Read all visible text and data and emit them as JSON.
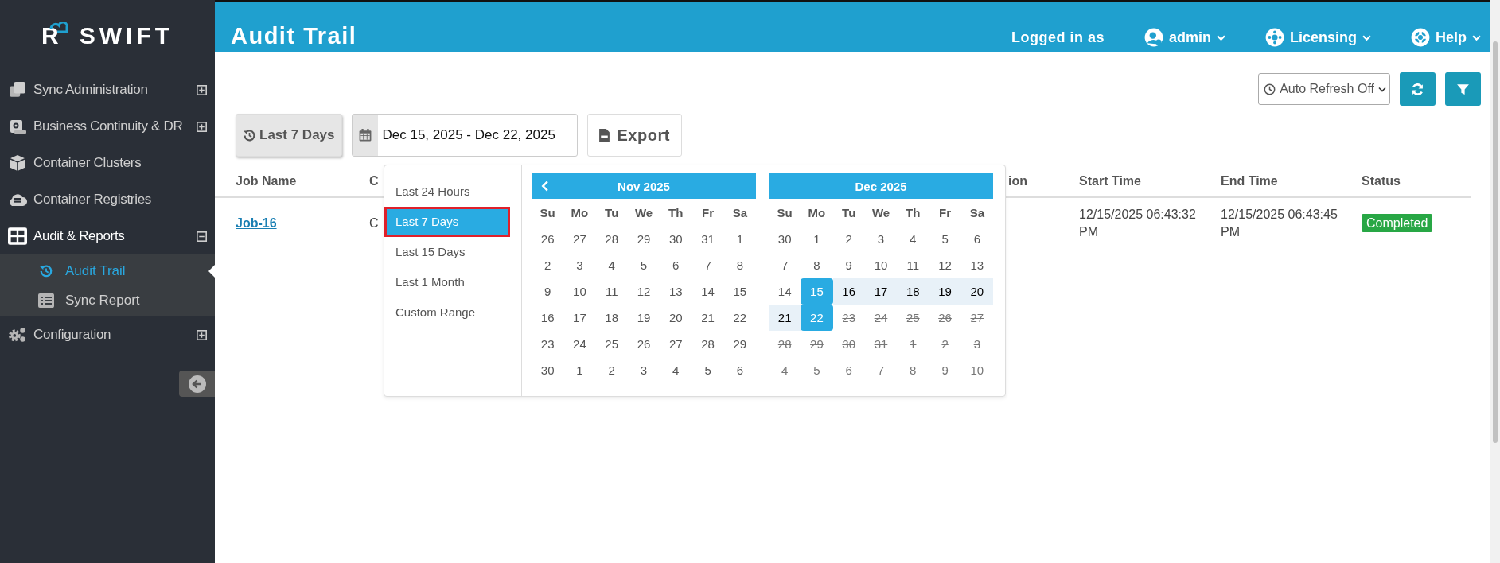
{
  "brand": {
    "mark": "R",
    "name": "SWIFT"
  },
  "sidebar": {
    "items": [
      {
        "label": "Sync Administration",
        "expanded": false
      },
      {
        "label": "Business Continuity & DR",
        "expanded": false
      },
      {
        "label": "Container Clusters"
      },
      {
        "label": "Container Registries"
      },
      {
        "label": "Audit & Reports",
        "expanded": true,
        "children": [
          {
            "label": "Audit Trail",
            "selected": true
          },
          {
            "label": "Sync Report",
            "selected": false
          }
        ]
      },
      {
        "label": "Configuration",
        "expanded": false
      }
    ]
  },
  "header": {
    "title": "Audit Trail",
    "logged_in_label": "Logged in as",
    "menus": [
      {
        "label": "admin"
      },
      {
        "label": "Licensing"
      },
      {
        "label": "Help"
      }
    ]
  },
  "toolbar": {
    "auto_refresh": "Auto Refresh Off",
    "preset_button": "Last 7 Days",
    "date_range": "Dec 15, 2025 - Dec 22, 2025",
    "export_button": "Export"
  },
  "table": {
    "columns": [
      "Job Name",
      "C",
      "ion",
      "Start Time",
      "End Time",
      "Status"
    ],
    "rows": [
      {
        "job": "Job-16",
        "column_2": "C",
        "start": "12/15/2025 06:43:32 PM",
        "end": "12/15/2025 06:43:45 PM",
        "status": "Completed"
      }
    ]
  },
  "date_picker": {
    "ranges": [
      {
        "label": "Last 24 Hours",
        "selected": false,
        "outlined": false
      },
      {
        "label": "Last 7 Days",
        "selected": true,
        "outlined": true
      },
      {
        "label": "Last 15 Days",
        "selected": false,
        "outlined": false
      },
      {
        "label": "Last 1 Month",
        "selected": false,
        "outlined": false
      },
      {
        "label": "Custom Range",
        "selected": false,
        "outlined": false
      }
    ],
    "months": [
      {
        "title": "Nov 2025",
        "weekdays": [
          "Su",
          "Mo",
          "Tu",
          "We",
          "Th",
          "Fr",
          "Sa"
        ],
        "weeks": [
          [
            {
              "d": "26",
              "kind": "normal"
            },
            {
              "d": "27",
              "kind": "normal"
            },
            {
              "d": "28",
              "kind": "normal"
            },
            {
              "d": "29",
              "kind": "normal"
            },
            {
              "d": "30",
              "kind": "normal"
            },
            {
              "d": "31",
              "kind": "normal"
            },
            {
              "d": "1",
              "kind": "normal"
            }
          ],
          [
            {
              "d": "2",
              "kind": "normal"
            },
            {
              "d": "3",
              "kind": "normal"
            },
            {
              "d": "4",
              "kind": "normal"
            },
            {
              "d": "5",
              "kind": "normal"
            },
            {
              "d": "6",
              "kind": "normal"
            },
            {
              "d": "7",
              "kind": "normal"
            },
            {
              "d": "8",
              "kind": "normal"
            }
          ],
          [
            {
              "d": "9",
              "kind": "normal"
            },
            {
              "d": "10",
              "kind": "normal"
            },
            {
              "d": "11",
              "kind": "normal"
            },
            {
              "d": "12",
              "kind": "normal"
            },
            {
              "d": "13",
              "kind": "normal"
            },
            {
              "d": "14",
              "kind": "normal"
            },
            {
              "d": "15",
              "kind": "normal"
            }
          ],
          [
            {
              "d": "16",
              "kind": "normal"
            },
            {
              "d": "17",
              "kind": "normal"
            },
            {
              "d": "18",
              "kind": "normal"
            },
            {
              "d": "19",
              "kind": "normal"
            },
            {
              "d": "20",
              "kind": "normal"
            },
            {
              "d": "21",
              "kind": "normal"
            },
            {
              "d": "22",
              "kind": "normal"
            }
          ],
          [
            {
              "d": "23",
              "kind": "normal"
            },
            {
              "d": "24",
              "kind": "normal"
            },
            {
              "d": "25",
              "kind": "normal"
            },
            {
              "d": "26",
              "kind": "normal"
            },
            {
              "d": "27",
              "kind": "normal"
            },
            {
              "d": "28",
              "kind": "normal"
            },
            {
              "d": "29",
              "kind": "normal"
            }
          ],
          [
            {
              "d": "30",
              "kind": "normal"
            },
            {
              "d": "1",
              "kind": "normal"
            },
            {
              "d": "2",
              "kind": "normal"
            },
            {
              "d": "3",
              "kind": "normal"
            },
            {
              "d": "4",
              "kind": "normal"
            },
            {
              "d": "5",
              "kind": "normal"
            },
            {
              "d": "6",
              "kind": "normal"
            }
          ]
        ]
      },
      {
        "title": "Dec 2025",
        "weekdays": [
          "Su",
          "Mo",
          "Tu",
          "We",
          "Th",
          "Fr",
          "Sa"
        ],
        "weeks": [
          [
            {
              "d": "30",
              "kind": "normal"
            },
            {
              "d": "1",
              "kind": "normal"
            },
            {
              "d": "2",
              "kind": "normal"
            },
            {
              "d": "3",
              "kind": "normal"
            },
            {
              "d": "4",
              "kind": "normal"
            },
            {
              "d": "5",
              "kind": "normal"
            },
            {
              "d": "6",
              "kind": "normal"
            }
          ],
          [
            {
              "d": "7",
              "kind": "normal"
            },
            {
              "d": "8",
              "kind": "normal"
            },
            {
              "d": "9",
              "kind": "normal"
            },
            {
              "d": "10",
              "kind": "normal"
            },
            {
              "d": "11",
              "kind": "normal"
            },
            {
              "d": "12",
              "kind": "normal"
            },
            {
              "d": "13",
              "kind": "normal"
            }
          ],
          [
            {
              "d": "14",
              "kind": "normal"
            },
            {
              "d": "15",
              "kind": "endpoint"
            },
            {
              "d": "16",
              "kind": "in_range"
            },
            {
              "d": "17",
              "kind": "in_range"
            },
            {
              "d": "18",
              "kind": "in_range"
            },
            {
              "d": "19",
              "kind": "in_range"
            },
            {
              "d": "20",
              "kind": "in_range"
            }
          ],
          [
            {
              "d": "21",
              "kind": "in_range"
            },
            {
              "d": "22",
              "kind": "endpoint"
            },
            {
              "d": "23",
              "kind": "disabled"
            },
            {
              "d": "24",
              "kind": "disabled"
            },
            {
              "d": "25",
              "kind": "disabled"
            },
            {
              "d": "26",
              "kind": "disabled"
            },
            {
              "d": "27",
              "kind": "disabled"
            }
          ],
          [
            {
              "d": "28",
              "kind": "disabled"
            },
            {
              "d": "29",
              "kind": "disabled"
            },
            {
              "d": "30",
              "kind": "disabled"
            },
            {
              "d": "31",
              "kind": "disabled"
            },
            {
              "d": "1",
              "kind": "disabled"
            },
            {
              "d": "2",
              "kind": "disabled"
            },
            {
              "d": "3",
              "kind": "disabled"
            }
          ],
          [
            {
              "d": "4",
              "kind": "disabled"
            },
            {
              "d": "5",
              "kind": "disabled"
            },
            {
              "d": "6",
              "kind": "disabled"
            },
            {
              "d": "7",
              "kind": "disabled"
            },
            {
              "d": "8",
              "kind": "disabled"
            },
            {
              "d": "9",
              "kind": "disabled"
            },
            {
              "d": "10",
              "kind": "disabled"
            }
          ]
        ]
      }
    ]
  }
}
